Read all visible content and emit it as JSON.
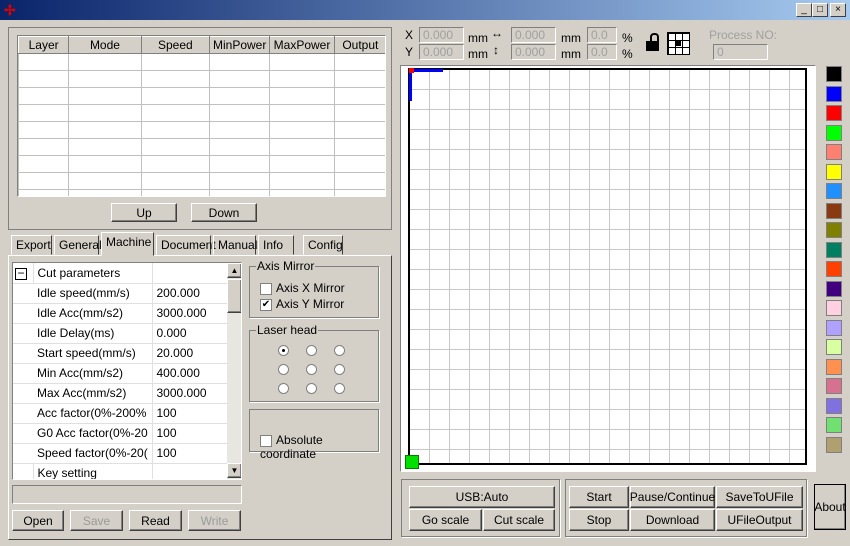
{
  "window": {
    "controls": [
      "_",
      "□",
      "×"
    ]
  },
  "layers": {
    "columns": [
      "Layer",
      "Mode",
      "Speed",
      "MinPower",
      "MaxPower",
      "Output"
    ],
    "rows": 9,
    "up": "Up",
    "down": "Down"
  },
  "tabs": [
    "Export",
    "General",
    "Machine",
    "Document",
    "Manual",
    "Info",
    "Config"
  ],
  "active_tab": "Machine",
  "machine": {
    "tree_toggle": "−",
    "group": "Cut parameters",
    "params": [
      [
        "Idle speed(mm/s)",
        "200.000"
      ],
      [
        "Idle Acc(mm/s2)",
        "3000.000"
      ],
      [
        "Idle Delay(ms)",
        "0.000"
      ],
      [
        "Start speed(mm/s)",
        "20.000"
      ],
      [
        "Min Acc(mm/s2)",
        "400.000"
      ],
      [
        "Max Acc(mm/s2)",
        "3000.000"
      ],
      [
        "Acc factor(0%-200%",
        "100"
      ],
      [
        "G0 Acc factor(0%-20",
        "100"
      ],
      [
        "Speed factor(0%-20(",
        "100"
      ]
    ],
    "key_setting": "Key setting",
    "axis_mirror": {
      "title": "Axis Mirror",
      "x": "Axis X Mirror",
      "x_checked": false,
      "y": "Axis Y Mirror",
      "y_checked": true
    },
    "laser_head": {
      "title": "Laser head",
      "selected": 0
    },
    "absolute": {
      "label": "Absolute coordinate",
      "checked": false
    }
  },
  "file_buttons": {
    "open": "Open",
    "save": "Save",
    "read": "Read",
    "write": "Write"
  },
  "coords": {
    "x_label": "X",
    "y_label": "Y",
    "x": "0.000",
    "y": "0.000",
    "w": "0.000",
    "h": "0.000",
    "unit": "mm",
    "sx": "0.0",
    "sy": "0.0",
    "pct": "%",
    "process_label": "Process NO:",
    "process": "0"
  },
  "controls": {
    "usb": "USB:Auto",
    "go_scale": "Go scale",
    "cut_scale": "Cut scale",
    "start": "Start",
    "pause": "Pause/Continue",
    "save_u": "SaveToUFile",
    "stop": "Stop",
    "download": "Download",
    "u_output": "UFileOutput",
    "about": "About"
  },
  "palette": [
    "#000000",
    "#0000ff",
    "#ff0000",
    "#00ff00",
    "#ff8070",
    "#ffff00",
    "#2090ff",
    "#8a3a10",
    "#808000",
    "#008060",
    "#ff4000",
    "#400080",
    "#ffd0e0",
    "#b0a0ff",
    "#d8ff a0",
    "#ff9050",
    "#d87090",
    "#8070e0",
    "#70e070",
    "#b0a070"
  ]
}
